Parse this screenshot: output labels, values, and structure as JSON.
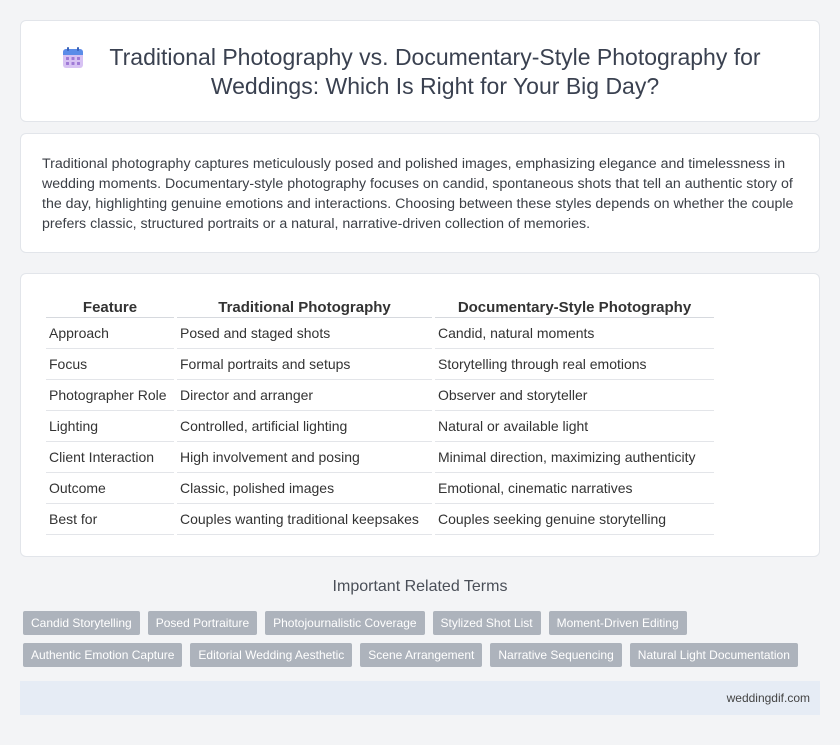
{
  "header": {
    "title": "Traditional Photography vs. Documentary-Style Photography for Weddings: Which Is Right for Your Big Day?",
    "icon": "calendar-icon"
  },
  "intro": {
    "text": "Traditional photography captures meticulously posed and polished images, emphasizing elegance and timelessness in wedding moments. Documentary-style photography focuses on candid, spontaneous shots that tell an authentic story of the day, highlighting genuine emotions and interactions. Choosing between these styles depends on whether the couple prefers classic, structured portraits or a natural, narrative-driven collection of memories."
  },
  "table": {
    "headers": [
      "Feature",
      "Traditional Photography",
      "Documentary-Style Photography"
    ],
    "rows": [
      [
        "Approach",
        "Posed and staged shots",
        "Candid, natural moments"
      ],
      [
        "Focus",
        "Formal portraits and setups",
        "Storytelling through real emotions"
      ],
      [
        "Photographer Role",
        "Director and arranger",
        "Observer and storyteller"
      ],
      [
        "Lighting",
        "Controlled, artificial lighting",
        "Natural or available light"
      ],
      [
        "Client Interaction",
        "High involvement and posing",
        "Minimal direction, maximizing authenticity"
      ],
      [
        "Outcome",
        "Classic, polished images",
        "Emotional, cinematic narratives"
      ],
      [
        "Best for",
        "Couples wanting traditional keepsakes",
        "Couples seeking genuine storytelling"
      ]
    ]
  },
  "related": {
    "title": "Important Related Terms",
    "tags_row1": [
      "Candid Storytelling",
      "Posed Portraiture",
      "Photojournalistic Coverage",
      "Stylized Shot List",
      "Moment-Driven Editing"
    ],
    "tags_row2": [
      "Authentic Emotion Capture",
      "Editorial Wedding Aesthetic",
      "Scene Arrangement",
      "Narrative Sequencing",
      "Natural Light Documentation"
    ]
  },
  "footer": {
    "site": "weddingdif.com"
  },
  "colors": {
    "icon_top": "#4a7fe0",
    "icon_body": "#c9a7ee",
    "tag_bg": "#adb3bc",
    "footer_bg": "#e6ecf5"
  }
}
